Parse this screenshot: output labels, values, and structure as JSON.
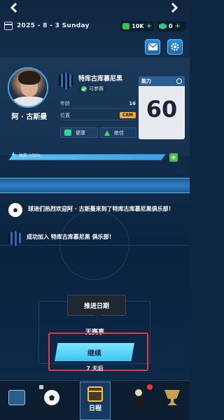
{
  "header": {
    "date": "2025 - 8 - 3   Sunday",
    "currency_cash": "10K",
    "currency_gems": "0"
  },
  "player": {
    "name": "阿 · 古斯曼",
    "club": "特库古库慕尼黑",
    "status": "可参赛",
    "age_label": "年龄",
    "age_value": "16",
    "position_label": "位置",
    "position_value": "CAM",
    "health_label": "健康",
    "form_label": "绝佳",
    "ability_label": "能力",
    "ability_value": "60",
    "stamina_label": "体能 100%",
    "stamina_fraction": 1.0
  },
  "messages": [
    {
      "text": "球迷们热烈欢迎阿 · 古斯曼来到了特库古库慕尼黑俱乐部！",
      "icon": "football-icon"
    },
    {
      "text": "成功加入 特库古库慕尼黑 俱乐部！",
      "icon": "club-badge-icon"
    }
  ],
  "advance_label": "推进日期",
  "no_match_label": "无赛事",
  "continue_label": "继续",
  "days_later_label": "7 天后",
  "bottom_nav": {
    "center_label": "日程"
  },
  "colors": {
    "accent": "#3ec4ef",
    "highlight": "#e0393f",
    "position_badge": "#f0a73a"
  }
}
